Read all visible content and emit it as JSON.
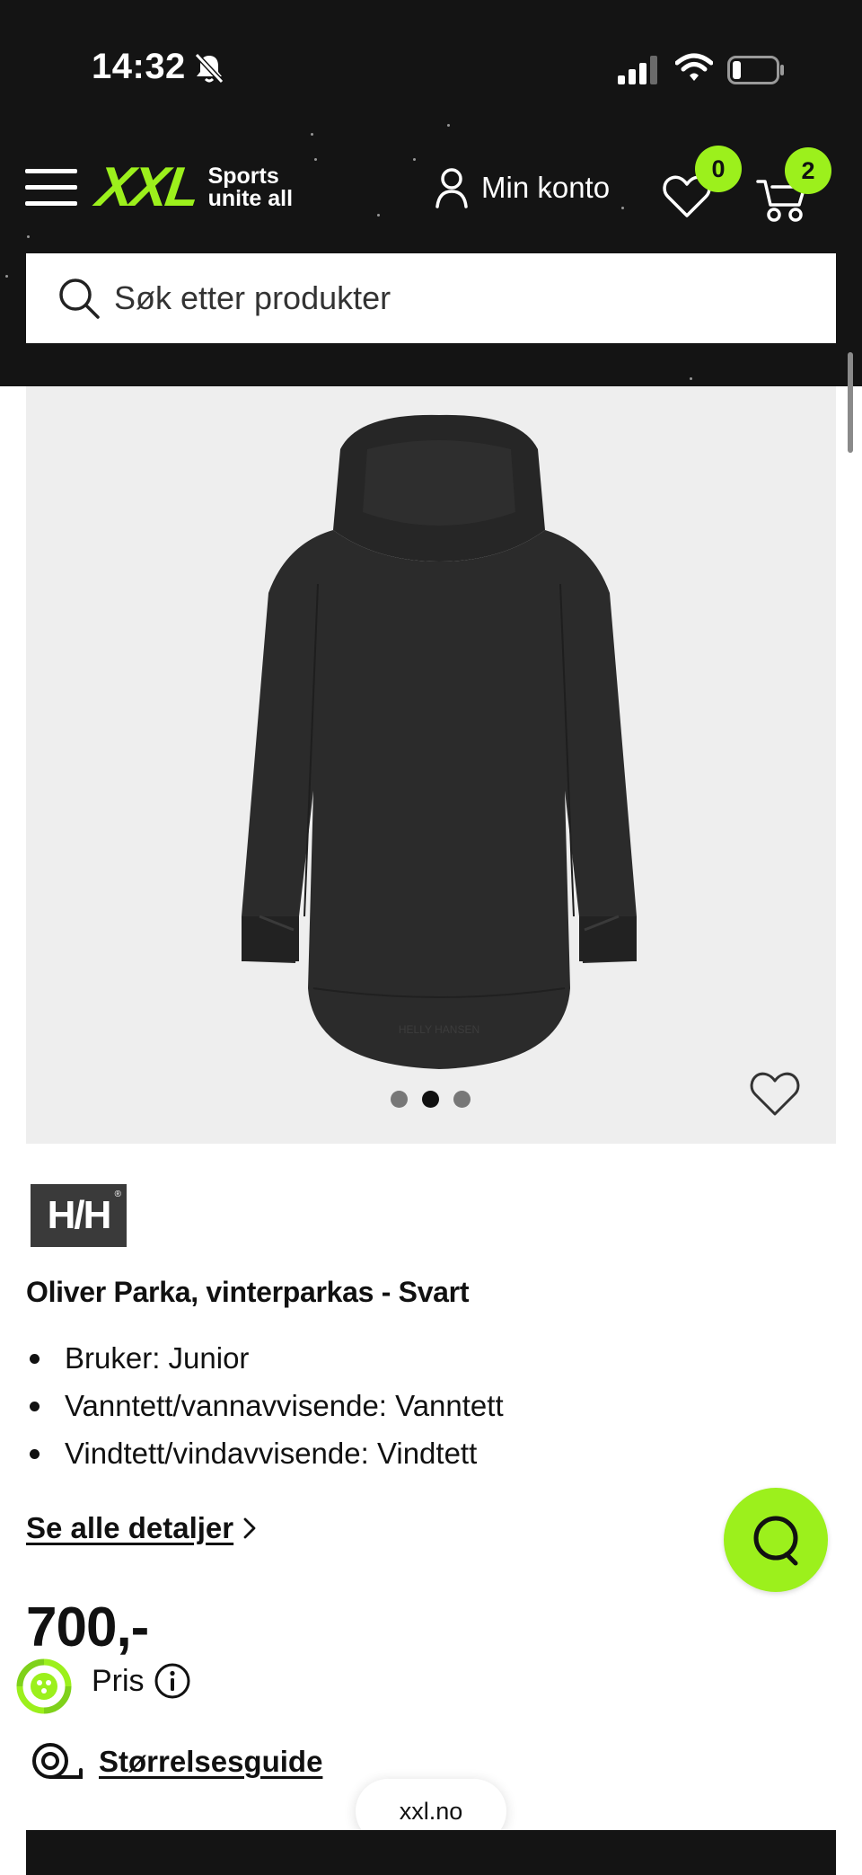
{
  "status_bar": {
    "time": "14:32"
  },
  "header": {
    "logo_text": "XXL",
    "tagline_line1": "Sports",
    "tagline_line2": "unite all",
    "account_label": "Min konto",
    "wishlist_count": "0",
    "cart_count": "2",
    "search_placeholder": "Søk etter produkter"
  },
  "colors": {
    "accent": "#9cf01c",
    "header_bg": "#141414",
    "gallery_bg": "#eeeeee"
  },
  "gallery": {
    "image_count": 3,
    "active_index": 1
  },
  "product": {
    "brand_logo": "H/H",
    "title": "Oliver Parka, vinterparkas - Svart",
    "features": [
      "Bruker: Junior",
      "Vanntett/vannavvisende: Vanntett",
      "Vindtett/vindavvisende: Vindtett"
    ],
    "details_link": "Se alle detaljer",
    "price": "700,-",
    "price_label": "Pris",
    "size_guide": "Størrelsesguide"
  },
  "browser": {
    "domain": "xxl.no"
  },
  "icons": {
    "menu": "hamburger-menu-icon",
    "account": "user-icon",
    "wishlist": "heart-icon",
    "cart": "cart-icon",
    "search": "search-icon",
    "chat": "chat-icon",
    "info": "info-icon",
    "size_guide": "tape-measure-icon"
  }
}
